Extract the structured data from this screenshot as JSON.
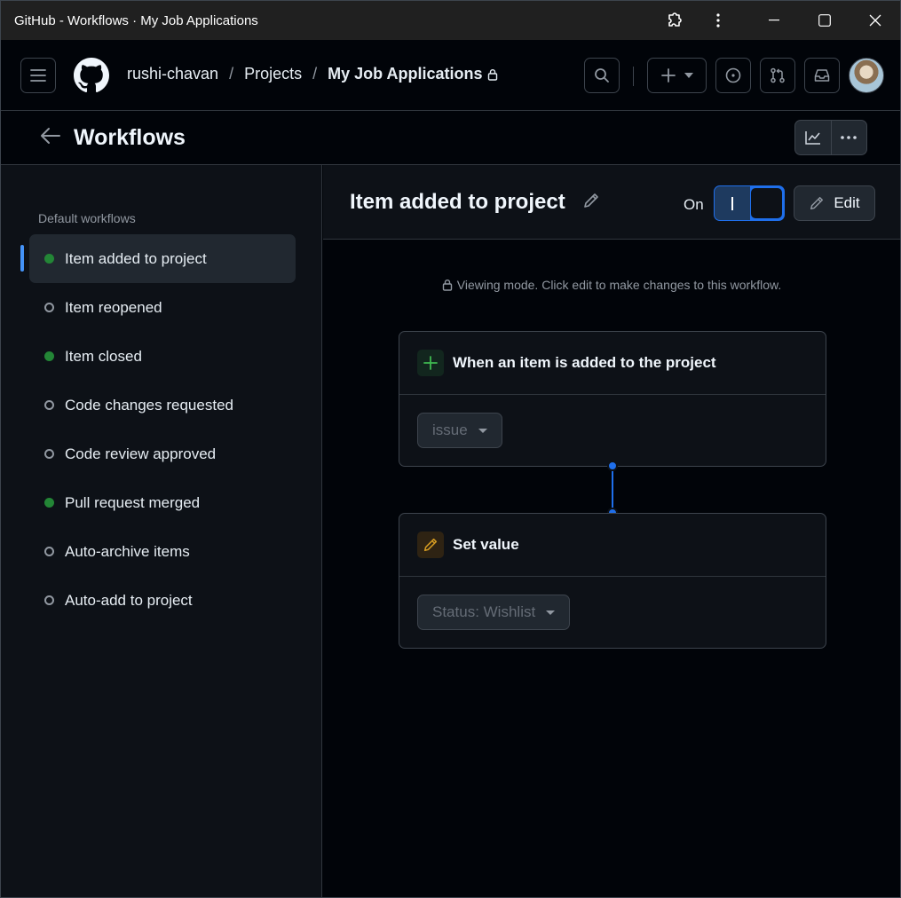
{
  "window": {
    "title": "GitHub - Workflows · My Job Applications"
  },
  "header": {
    "breadcrumb": {
      "owner": "rushi-chavan",
      "sep1": "/",
      "projects": "Projects",
      "sep2": "/",
      "project": "My Job Applications"
    },
    "icons": [
      "hamburger-icon",
      "github-logo",
      "search-icon",
      "plus-icon",
      "issues-icon",
      "pull-request-icon",
      "inbox-icon"
    ]
  },
  "subheader": {
    "title": "Workflows"
  },
  "sidebar": {
    "heading": "Default workflows",
    "items": [
      {
        "label": "Item added to project",
        "enabled": true,
        "active": true
      },
      {
        "label": "Item reopened",
        "enabled": false,
        "active": false
      },
      {
        "label": "Item closed",
        "enabled": true,
        "active": false
      },
      {
        "label": "Code changes requested",
        "enabled": false,
        "active": false
      },
      {
        "label": "Code review approved",
        "enabled": false,
        "active": false
      },
      {
        "label": "Pull request merged",
        "enabled": true,
        "active": false
      },
      {
        "label": "Auto-archive items",
        "enabled": false,
        "active": false
      },
      {
        "label": "Auto-add to project",
        "enabled": false,
        "active": false
      }
    ]
  },
  "workflow": {
    "title": "Item added to project",
    "toggle_label": "On",
    "toggle_on": true,
    "edit_label": "Edit",
    "viewing_notice": "Viewing mode. Click edit to make changes to this workflow.",
    "trigger": {
      "title": "When an item is added to the project",
      "select_value": "issue"
    },
    "action": {
      "title": "Set value",
      "select_value": "Status: Wishlist"
    }
  },
  "colors": {
    "accent": "#1f6feb",
    "enabled_dot": "#238636",
    "trigger_icon": "#3fb950",
    "action_icon": "#d29922"
  }
}
